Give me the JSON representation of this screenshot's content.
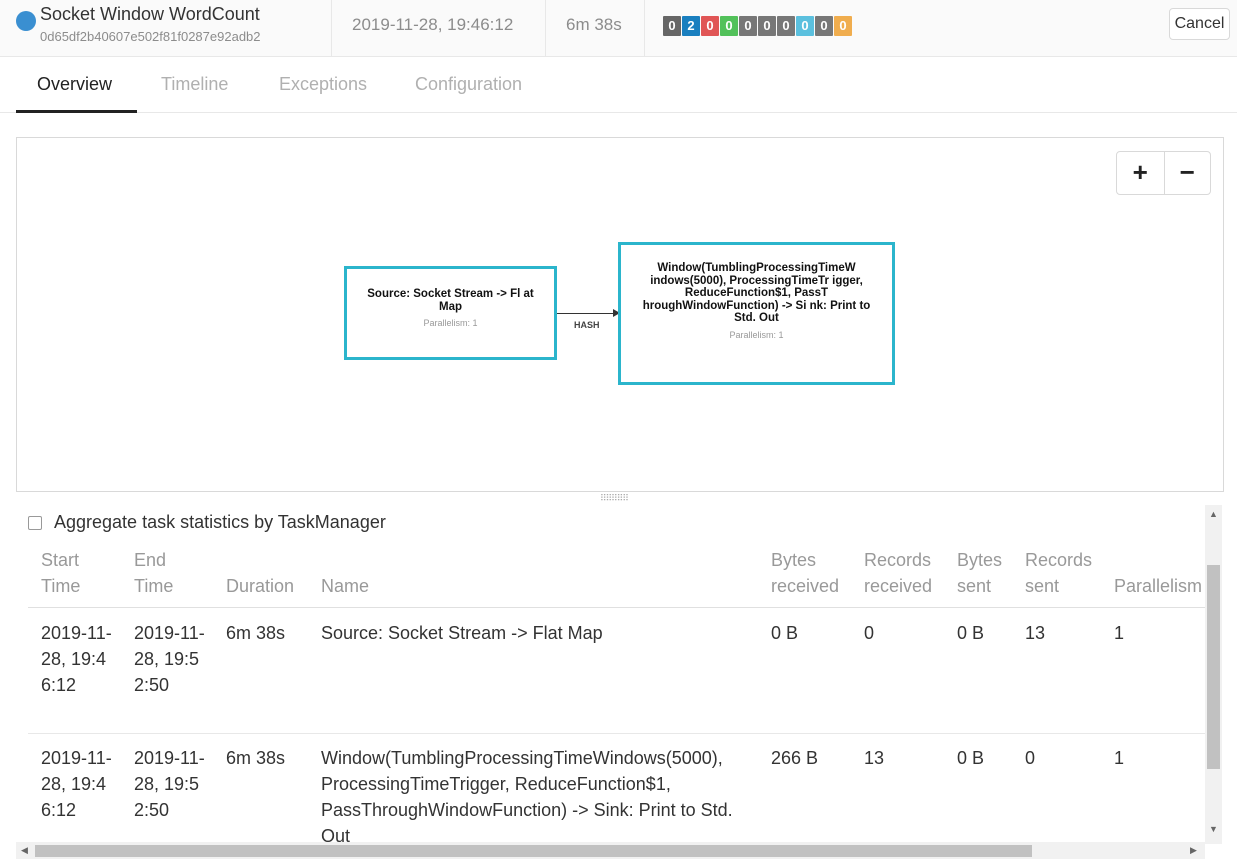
{
  "header": {
    "job_name": "Socket Window WordCount",
    "job_id": "0d65df2b40607e502f81f0287e92adb2",
    "start_time": "2019-11-28, 19:46:12",
    "duration": "6m 38s",
    "status_badges": [
      {
        "value": "0",
        "color": "#666666"
      },
      {
        "value": "2",
        "color": "#1a7fbf"
      },
      {
        "value": "0",
        "color": "#e05555"
      },
      {
        "value": "0",
        "color": "#52c15a"
      },
      {
        "value": "0",
        "color": "#777777"
      },
      {
        "value": "0",
        "color": "#777777"
      },
      {
        "value": "0",
        "color": "#777777"
      },
      {
        "value": "0",
        "color": "#5bc0de"
      },
      {
        "value": "0",
        "color": "#777777"
      },
      {
        "value": "0",
        "color": "#f0ad4e"
      }
    ],
    "cancel_label": "Cancel"
  },
  "tabs": [
    {
      "label": "Overview",
      "active": true
    },
    {
      "label": "Timeline",
      "active": false
    },
    {
      "label": "Exceptions",
      "active": false
    },
    {
      "label": "Configuration",
      "active": false
    }
  ],
  "graph": {
    "zoom_in": "+",
    "zoom_out": "−",
    "nodes": [
      {
        "title": "Source: Socket Stream -> Fl at Map",
        "parallelism": "Parallelism: 1"
      },
      {
        "title": "Window(TumblingProcessingTimeW indows(5000), ProcessingTimeTr igger, ReduceFunction$1, PassT hroughWindowFunction) -> Si nk: Print to Std. Out",
        "parallelism": "Parallelism: 1"
      }
    ],
    "edge_label": "HASH"
  },
  "aggregate_label": "Aggregate task statistics by TaskManager",
  "table": {
    "columns": [
      "Start Time",
      "End Time",
      "Duration",
      "Name",
      "Bytes received",
      "Records received",
      "Bytes sent",
      "Records sent",
      "Parallelism"
    ],
    "rows": [
      {
        "start": "2019-11-28, 19:46:12",
        "end": "2019-11-28, 19:52:50",
        "duration": "6m 38s",
        "name": "Source: Socket Stream -> Flat Map",
        "bytes_received": "0 B",
        "records_received": "0",
        "bytes_sent": "0 B",
        "records_sent": "13",
        "parallelism": "1"
      },
      {
        "start": "2019-11-28, 19:46:12",
        "end": "2019-11-28, 19:52:50",
        "duration": "6m 38s",
        "name": "Window(TumblingProcessingTimeWindows(5000), ProcessingTimeTrigger, ReduceFunction$1, PassThroughWindowFunction) -> Sink: Print to Std. Out",
        "bytes_received": "266 B",
        "records_received": "13",
        "bytes_sent": "0 B",
        "records_sent": "0",
        "parallelism": "1"
      }
    ]
  }
}
